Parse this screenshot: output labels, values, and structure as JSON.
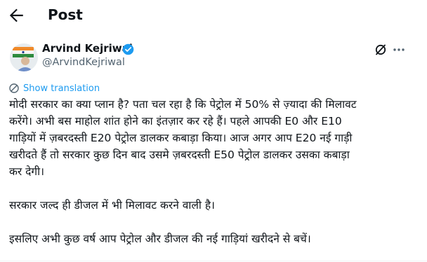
{
  "header": {
    "title": "Post"
  },
  "author": {
    "name": "Arvind Kejriwal",
    "handle": "@ArvindKejriwal",
    "verified_color": "#1d9bf0"
  },
  "translate": {
    "label": "Show translation"
  },
  "post": {
    "paragraph1": [
      "मोदी सरकार का क्या प्लान है? पता चल रहा है कि पेट्रोल में 50% से ज़्यादा की मिलावट",
      "करेंगे। अभी बस माहोल शांत होने का इंतज़ार कर रहे हैं। पहले आपकी E0 और E10",
      "गाड़ियों में ज़बरदस्ती E20 पेट्रोल डालकर कबाड़ा किया। आज अगर आप E20 नई गाड़ी",
      "खरीदते हैं तो सरकार कुछ दिन बाद उसमे ज़बरदस्ती E50 पेट्रोल डालकर उसका कबाड़ा",
      "कर देगी।"
    ],
    "paragraph2": "सरकार जल्द ही डीजल में भी मिलावट करने वाली है।",
    "paragraph3": "इसलिए अभी कुछ वर्ष आप पेट्रोल और डीजल की नई गाड़ियां खरीदने से बचें।"
  },
  "icons": {
    "back": "arrow-left-icon",
    "verified": "verified-badge-icon",
    "grok": "grok-icon",
    "more": "more-horizontal-icon",
    "translate": "translate-icon"
  },
  "colors": {
    "accent": "#1d9bf0",
    "text": "#0f1419",
    "secondary": "#536471"
  }
}
